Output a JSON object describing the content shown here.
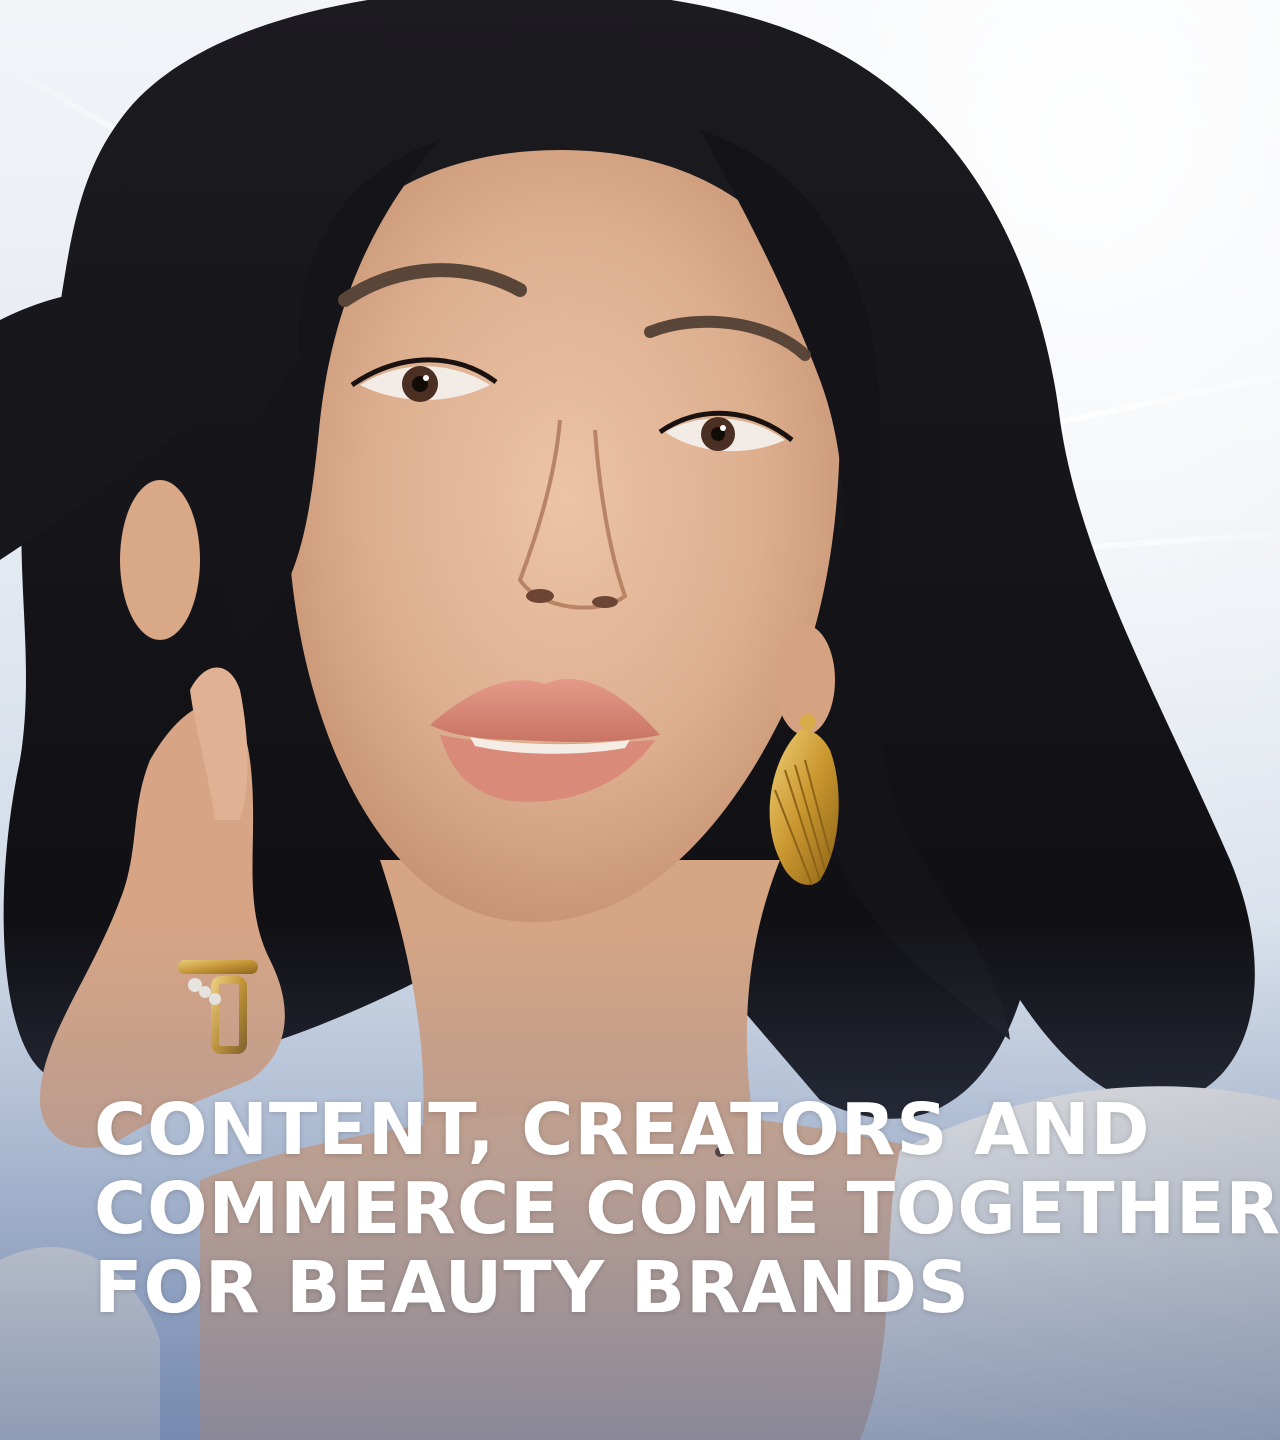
{
  "hero": {
    "headline_lines": [
      "CONTENT, CREATORS AND",
      "COMMERCE COME TOGETHER",
      "FOR BEAUTY BRANDS"
    ]
  },
  "image": {
    "subject": "beauty-portrait",
    "icon": "portrait-photo"
  },
  "colors": {
    "background_top": "#f2f4f8",
    "background_bottom": "#9fb0cc",
    "hair": "#141418",
    "skin": "#e0b394",
    "lips": "#d98c7c",
    "gold": "#c9962e",
    "sweater": "#efece6",
    "headline_text": "#ffffff"
  }
}
